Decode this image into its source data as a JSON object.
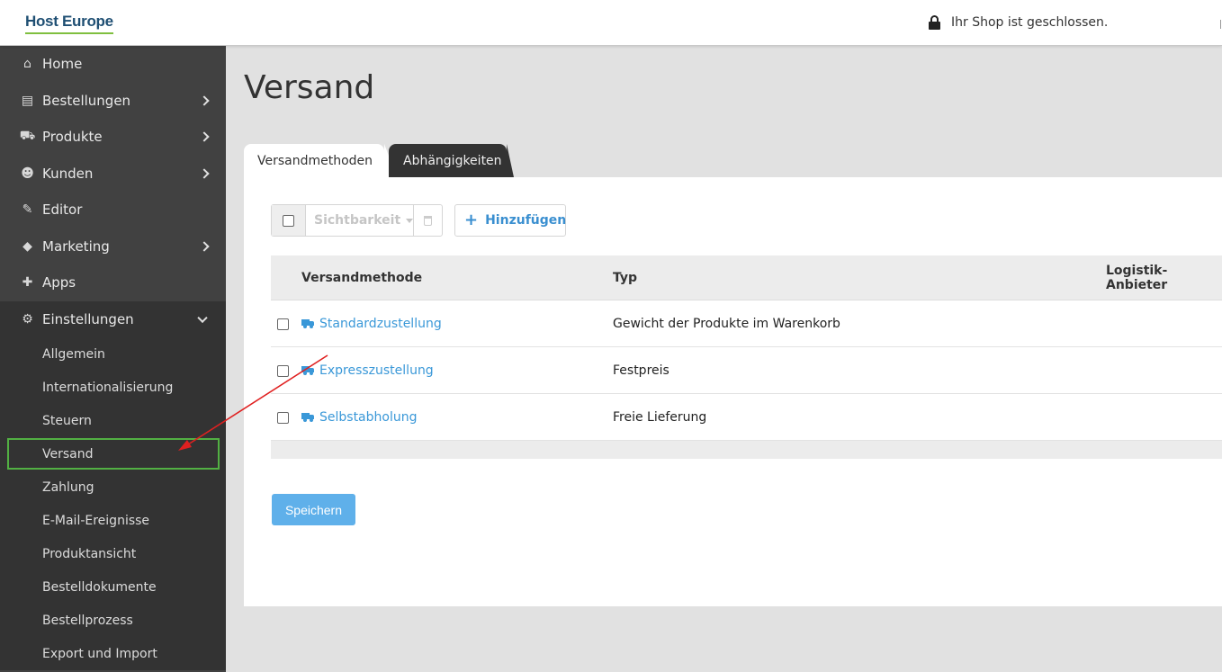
{
  "brand": {
    "logo_text": "Host Europe"
  },
  "header": {
    "shop_status": "Ihr Shop ist geschlossen."
  },
  "sidebar": {
    "items": [
      {
        "label": "Home",
        "icon": "home-icon",
        "expandable": false
      },
      {
        "label": "Bestellungen",
        "icon": "orders-icon",
        "expandable": true
      },
      {
        "label": "Produkte",
        "icon": "cart-icon",
        "expandable": true
      },
      {
        "label": "Kunden",
        "icon": "users-icon",
        "expandable": true
      },
      {
        "label": "Editor",
        "icon": "pencil-icon",
        "expandable": false
      },
      {
        "label": "Marketing",
        "icon": "tag-icon",
        "expandable": true
      },
      {
        "label": "Apps",
        "icon": "puzzle-icon",
        "expandable": false
      },
      {
        "label": "Einstellungen",
        "icon": "gear-icon",
        "expandable": true,
        "open": true
      }
    ],
    "sub_items": [
      "Allgemein",
      "Internationalisierung",
      "Steuern",
      "Versand",
      "Zahlung",
      "E-Mail-Ereignisse",
      "Produktansicht",
      "Bestelldokumente",
      "Bestellprozess",
      "Export und Import"
    ],
    "active_sub_item": "Versand"
  },
  "main": {
    "title": "Versand",
    "tabs": [
      {
        "label": "Versandmethoden",
        "active": true
      },
      {
        "label": "Abhängigkeiten",
        "active": false
      }
    ],
    "toolbar": {
      "visibility_label": "Sichtbarkeit",
      "add_label": "Hinzufügen"
    },
    "table": {
      "columns": [
        "Versandmethode",
        "Typ",
        "Logistik-Anbieter"
      ],
      "rows": [
        {
          "name": "Standardzustellung",
          "type": "Gewicht der Produkte im Warenkorb"
        },
        {
          "name": "Expresszustellung",
          "type": "Festpreis"
        },
        {
          "name": "Selbstabholung",
          "type": "Freie Lieferung"
        }
      ]
    },
    "save_label": "Speichern"
  },
  "colors": {
    "sidebar_bg": "#414141",
    "link_blue": "#3a98d8",
    "save_button": "#5fb0ea",
    "active_outline": "#52b043",
    "annotation_arrow": "#e02020"
  }
}
